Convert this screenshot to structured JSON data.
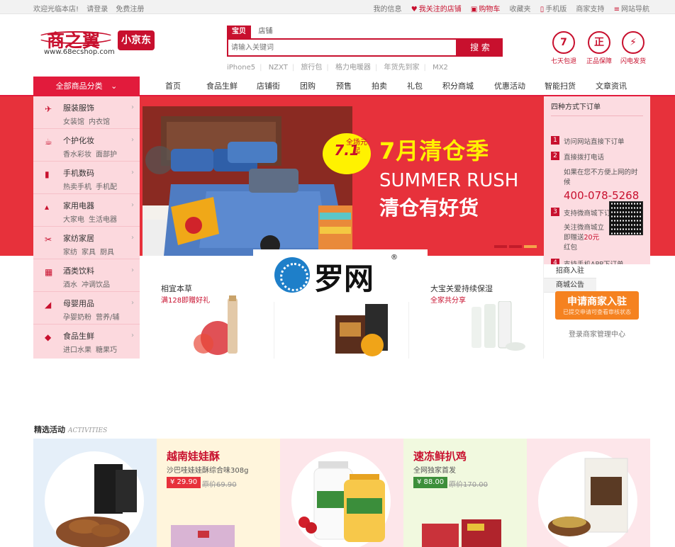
{
  "topbar": {
    "welcome": "欢迎光临本店!",
    "login": "请登录",
    "register": "免费注册",
    "right": [
      "我的信息",
      "我关注的店铺",
      "购物车",
      "收藏夹",
      "手机版",
      "商家支持",
      "网站导航"
    ]
  },
  "logo": {
    "name": "商之翼",
    "domain": "www.68ecshop.com",
    "badge": "小京东"
  },
  "search": {
    "tabs": [
      "宝贝",
      "店铺"
    ],
    "placeholder": "请输入关键词",
    "button": "搜 索",
    "hot": [
      "iPhone5",
      "NZXT",
      "旅行包",
      "格力电暖器",
      "年货先到家",
      "MX2"
    ]
  },
  "services": [
    {
      "icon": "7",
      "label": "七天包退"
    },
    {
      "icon": "正",
      "label": "正品保障"
    },
    {
      "icon": "⚡",
      "label": "闪电发货"
    }
  ],
  "nav": {
    "all": "全部商品分类",
    "items": [
      "首页",
      "食品生鲜",
      "店铺街",
      "团购",
      "预售",
      "拍卖",
      "礼包",
      "积分商城",
      "优惠活动",
      "智能扫货",
      "文章资讯"
    ]
  },
  "categories": [
    {
      "name": "服装服饰",
      "sub": [
        "女装馆",
        "内衣馆"
      ]
    },
    {
      "name": "个护化妆",
      "sub": [
        "香水彩妆",
        "面部护"
      ]
    },
    {
      "name": "手机数码",
      "sub": [
        "热卖手机",
        "手机配"
      ]
    },
    {
      "name": "家用电器",
      "sub": [
        "大家电",
        "生活电器"
      ]
    },
    {
      "name": "家纺家居",
      "sub": [
        "家纺",
        "家具",
        "厨具"
      ]
    },
    {
      "name": "酒类饮料",
      "sub": [
        "酒水",
        "冲调饮品"
      ]
    },
    {
      "name": "母婴用品",
      "sub": [
        "孕婴奶粉",
        "营养/辅"
      ]
    },
    {
      "name": "食品生鲜",
      "sub": [
        "进口水果",
        "糖果巧"
      ]
    }
  ],
  "banner": {
    "tag_main": "7.1",
    "tag_side": "全场元起",
    "headline": "7月清仓季",
    "english": "SUMMER RUSH",
    "subline": "清仓有好货"
  },
  "order_panel": {
    "title": "四种方式下订单",
    "steps": [
      {
        "n": "1",
        "text": "访问网站直接下订单"
      },
      {
        "n": "2",
        "text": "直接拨打电话"
      },
      {
        "n": "3",
        "text": "支持微商城下订单"
      },
      {
        "n": "4",
        "text": "支持手机APP下订单"
      }
    ],
    "step2_note": "如果在您不方便上网的时候",
    "phone": "400-078-5268",
    "step3_note1": "关注微商城立",
    "step3_note2": "即赠送",
    "step3_amount": "20元",
    "step3_note3": "红包"
  },
  "merchant": {
    "tabs": [
      "招商入驻",
      "商城公告"
    ],
    "apply": "申请商家入驻",
    "apply_sub": "已提交申请可查看审核状态",
    "center": "登录商家管理中心"
  },
  "promos": [
    {
      "title": "相宜本草",
      "sub": "满128即赠好礼"
    },
    {
      "title": "",
      "sub": ""
    },
    {
      "title": "大宝关爱持续保湿",
      "sub": "全家共分享"
    }
  ],
  "watermark": {
    "text": "罗网",
    "reg": "®"
  },
  "activities": {
    "title": "精选活动",
    "en": "ACTIVITIES",
    "items": [
      {
        "title": "越南娃娃酥",
        "sub": "沙巴哇娃娃酥综合味308g",
        "price": "¥ 29.90",
        "old": "原价69.90"
      },
      {
        "title": "速冻鲜扒鸡",
        "sub": "全网独家首发",
        "price": "¥ 88.00",
        "old": "原价170.00"
      }
    ]
  },
  "colors": {
    "brand": "#c8102e",
    "nav_red": "#e21b3c",
    "banner_bg": "#e7313b",
    "orange": "#f58220"
  }
}
